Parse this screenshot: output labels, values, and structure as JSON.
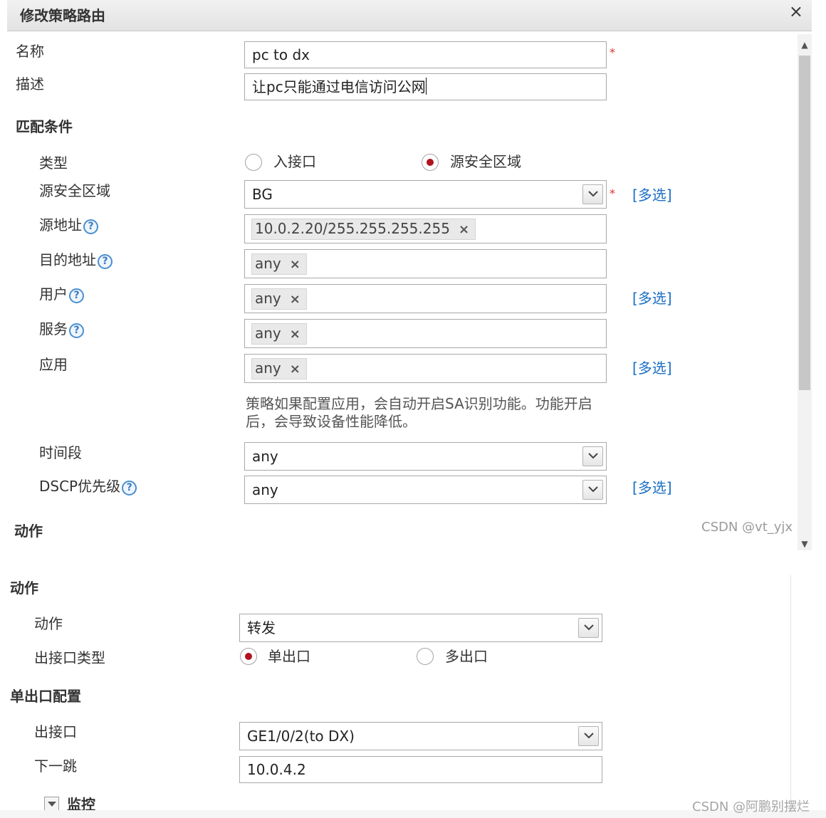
{
  "dialog": {
    "title": "修改策略路由",
    "close_symbol": "×"
  },
  "fields": {
    "name_label": "名称",
    "name_value": "pc to dx",
    "desc_label": "描述",
    "desc_value": "让pc只能通过电信访问公网",
    "required_mark": "*"
  },
  "match": {
    "section_title": "匹配条件",
    "type_label": "类型",
    "type_options": [
      "入接口",
      "源安全区域"
    ],
    "type_selected": "源安全区域",
    "src_zone_label": "源安全区域",
    "src_zone_value": "BG",
    "src_addr_label": "源地址",
    "src_addr_tag": "10.0.2.20/255.255.255.255",
    "dst_addr_label": "目的地址",
    "dst_addr_tag": "any",
    "user_label": "用户",
    "user_tag": "any",
    "service_label": "服务",
    "service_tag": "any",
    "app_label": "应用",
    "app_tag": "any",
    "app_hint_line1": "策略如果配置应用，会自动开启SA识别功能。功能开启",
    "app_hint_line2": "后，会导致设备性能降低。",
    "time_label": "时间段",
    "time_value": "any",
    "dscp_label": "DSCP优先级",
    "dscp_value": "any",
    "multi_select": "[多选]",
    "help_symbol": "?",
    "tag_remove": "×"
  },
  "action_top": {
    "section_title": "动作"
  },
  "action": {
    "section_title": "动作",
    "action_label": "动作",
    "action_value": "转发",
    "out_type_label": "出接口类型",
    "out_type_options": [
      "单出口",
      "多出口"
    ],
    "out_type_selected": "单出口",
    "single_section_title": "单出口配置",
    "out_if_label": "出接口",
    "out_if_value": "GE1/0/2(to DX)",
    "next_hop_label": "下一跳",
    "next_hop_value": "10.0.4.2",
    "monitor_label": "监控"
  },
  "watermarks": {
    "top": "CSDN @vt_yjx",
    "bottom": "CSDN @阿鹏别摆烂"
  },
  "colors": {
    "link": "#1a6fc4",
    "required": "#e0302b",
    "radio_selected": "#b1121c"
  }
}
